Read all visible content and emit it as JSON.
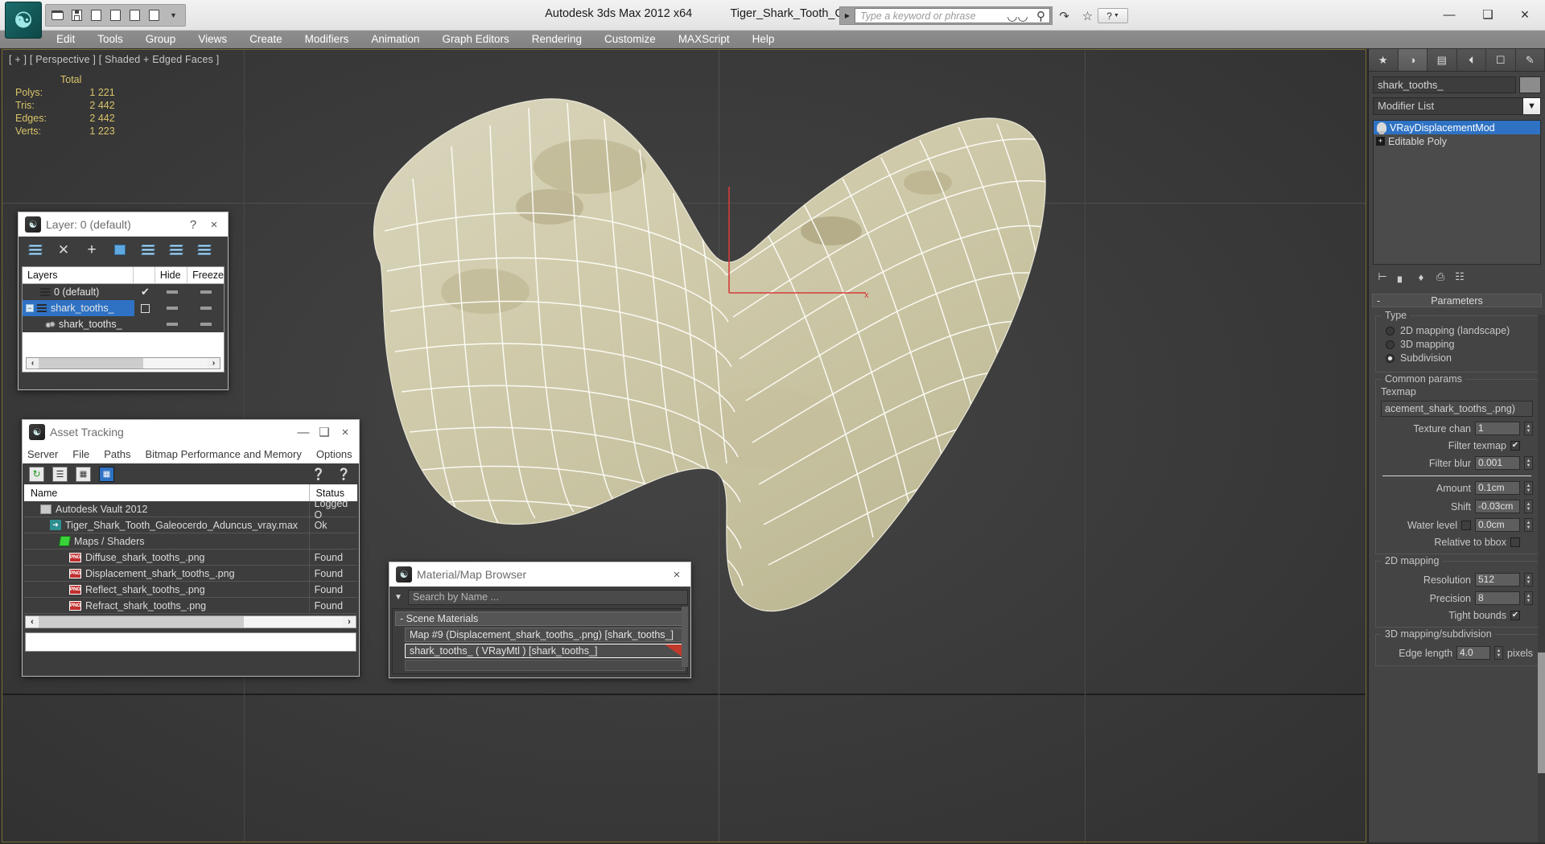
{
  "titlebar": {
    "app_title": "Autodesk 3ds Max  2012 x64",
    "file_title": "Tiger_Shark_Tooth_Galeocerdo_Aduncus_vray.max",
    "search_placeholder": "Type a keyword or phrase",
    "help_label": "?",
    "minimize": "—",
    "maximize": "❑",
    "close": "×",
    "quick_access": [
      "open-icon",
      "save-icon",
      "new-icon",
      "reference-icon",
      "undo-icon",
      "redo-icon",
      "chevron-down-icon"
    ]
  },
  "menubar": {
    "items": [
      "Edit",
      "Tools",
      "Group",
      "Views",
      "Create",
      "Modifiers",
      "Animation",
      "Graph Editors",
      "Rendering",
      "Customize",
      "MAXScript",
      "Help"
    ]
  },
  "viewport": {
    "label": "[ + ] [ Perspective ] [ Shaded + Edged Faces ]",
    "stats": {
      "column_header": "Total",
      "rows": [
        {
          "label": "Polys:",
          "value": "1 221"
        },
        {
          "label": "Tris:",
          "value": "2 442"
        },
        {
          "label": "Edges:",
          "value": "2 442"
        },
        {
          "label": "Verts:",
          "value": "1 223"
        }
      ]
    }
  },
  "command_panel": {
    "tabs": [
      "create-tab",
      "modify-tab",
      "hierarchy-tab",
      "motion-tab",
      "display-tab",
      "utilities-tab"
    ],
    "object_name": "shark_tooths_",
    "modifier_list_label": "Modifier List",
    "stack": [
      {
        "label": "VRayDisplacementMod",
        "selected": true
      },
      {
        "label": "Editable Poly",
        "selected": false
      }
    ],
    "rollup": {
      "title": "Parameters",
      "collapse_glyph": "-",
      "type_group": {
        "title": "Type",
        "options": [
          {
            "label": "2D mapping (landscape)",
            "selected": false
          },
          {
            "label": "3D mapping",
            "selected": false
          },
          {
            "label": "Subdivision",
            "selected": true
          }
        ]
      },
      "common_group": {
        "title": "Common params",
        "texmap_label": "Texmap",
        "texmap_value": "acement_shark_tooths_.png)",
        "texture_chan_label": "Texture chan",
        "texture_chan_value": "1",
        "filter_texmap_label": "Filter texmap",
        "filter_texmap_checked": "✔",
        "filter_blur_label": "Filter blur",
        "filter_blur_value": "0.001",
        "amount_label": "Amount",
        "amount_value": "0.1cm",
        "shift_label": "Shift",
        "shift_value": "-0.03cm",
        "water_level_label": "Water level",
        "water_level_value": "0.0cm",
        "relative_bbox_label": "Relative to bbox"
      },
      "mapping2d_group": {
        "title": "2D mapping",
        "resolution_label": "Resolution",
        "resolution_value": "512",
        "precision_label": "Precision",
        "precision_value": "8",
        "tight_bounds_label": "Tight bounds",
        "tight_bounds_checked": "✔"
      },
      "mapping3d_group": {
        "title": "3D mapping/subdivision",
        "edge_length_label": "Edge length",
        "edge_length_value": "4.0",
        "edge_length_units": "pixels"
      }
    }
  },
  "layer_window": {
    "title": "Layer: 0 (default)",
    "help_glyph": "?",
    "close_glyph": "×",
    "toolbar": [
      "create-new-layer-icon",
      "delete-layer-icon",
      "add-layer-icon",
      "select-objects-icon",
      "select-highlighted-icon",
      "highlight-selected-icon",
      "layer-properties-icon"
    ],
    "columns": [
      "Layers",
      "",
      "Hide",
      "Freeze"
    ],
    "rows": [
      {
        "name": "0 (default)",
        "indent": 0,
        "current": "✔",
        "selected": false,
        "expander": false
      },
      {
        "name": "shark_tooths_",
        "indent": 0,
        "current": "",
        "selected": true,
        "expander": true
      },
      {
        "name": "shark_tooths_",
        "indent": 1,
        "current": "",
        "selected": false,
        "expander": false
      }
    ],
    "scroll_left": "‹",
    "scroll_right": "›"
  },
  "asset_window": {
    "title": "Asset Tracking",
    "minimize": "—",
    "maximize": "❑",
    "close": "×",
    "menu": [
      "Server",
      "File",
      "Paths",
      "Bitmap Performance and Memory",
      "Options"
    ],
    "toolbar": [
      "refresh-icon",
      "list-view-icon",
      "detail-view-icon",
      "grid-view-icon"
    ],
    "help_icons": [
      "help-icon",
      "context-help-icon"
    ],
    "columns": [
      "Name",
      "Status"
    ],
    "rows": [
      {
        "name": "Autodesk Vault 2012",
        "status": "Logged O",
        "indent": 0,
        "icon": "vault-icon"
      },
      {
        "name": "Tiger_Shark_Tooth_Galeocerdo_Aduncus_vray.max",
        "status": "Ok",
        "indent": 1,
        "icon": "max-file-icon"
      },
      {
        "name": "Maps / Shaders",
        "status": "",
        "indent": 2,
        "icon": "maps-shaders-icon"
      },
      {
        "name": "Diffuse_shark_tooths_.png",
        "status": "Found",
        "indent": 3,
        "icon": "png-icon"
      },
      {
        "name": "Displacement_shark_tooths_.png",
        "status": "Found",
        "indent": 3,
        "icon": "png-icon"
      },
      {
        "name": "Reflect_shark_tooths_.png",
        "status": "Found",
        "indent": 3,
        "icon": "png-icon"
      },
      {
        "name": "Refract_shark_tooths_.png",
        "status": "Found",
        "indent": 3,
        "icon": "png-icon"
      }
    ],
    "scroll_left": "‹",
    "scroll_right": "›"
  },
  "material_browser": {
    "title": "Material/Map Browser",
    "close_glyph": "×",
    "search_placeholder": "Search by Name ...",
    "group_label": "- Scene Materials",
    "items": [
      {
        "label": "Map #9 (Displacement_shark_tooths_.png) [shark_tooths_]",
        "selected": false
      },
      {
        "label": "shark_tooths_  ( VRayMtl ) [shark_tooths_]",
        "selected": true
      }
    ]
  },
  "colors": {
    "accent_blue": "#2f72c4",
    "viewport_bg": "#3b3b3b",
    "stats_yellow": "#d8c46a",
    "tooth_base": "#d8d3b5",
    "panel_bg": "#444444",
    "gizmo_red": "#d43b3b"
  }
}
